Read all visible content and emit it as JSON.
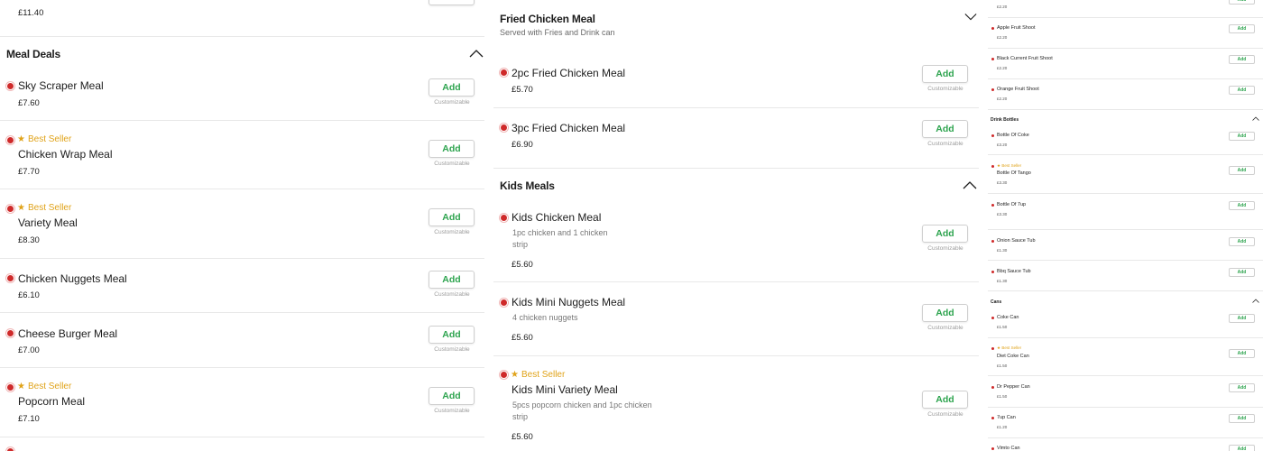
{
  "col1": {
    "top_price": "£11.40",
    "meal_deals": {
      "title": "Meal Deals",
      "items": [
        {
          "name": "Sky Scraper Meal",
          "price": "£7.60",
          "best_seller": false
        },
        {
          "name": "Chicken Wrap Meal",
          "price": "£7.70",
          "best_seller": true
        },
        {
          "name": "Variety Meal",
          "price": "£8.30",
          "best_seller": true
        },
        {
          "name": "Chicken Nuggets Meal",
          "price": "£6.10",
          "best_seller": false
        },
        {
          "name": "Cheese Burger Meal",
          "price": "£7.00",
          "best_seller": false
        },
        {
          "name": "Popcorn Meal",
          "price": "£7.10",
          "best_seller": true
        }
      ]
    }
  },
  "col2": {
    "fried": {
      "title": "Fried Chicken Meal",
      "subtitle": "Served with Fries and Drink can",
      "items": [
        {
          "name": "2pc Fried Chicken Meal",
          "price": "£5.70"
        },
        {
          "name": "3pc Fried Chicken Meal",
          "price": "£6.90"
        }
      ]
    },
    "kids": {
      "title": "Kids Meals",
      "items": [
        {
          "name": "Kids Chicken Meal",
          "desc1": "1pc chicken and 1 chicken",
          "desc2": "strip",
          "price": "£5.60",
          "best_seller": false
        },
        {
          "name": "Kids Mini Nuggets Meal",
          "desc1": "4 chicken nuggets",
          "desc2": "",
          "price": "£5.60",
          "best_seller": false
        },
        {
          "name": "Kids Mini Variety Meal",
          "desc1": "5pcs popcorn chicken and 1pc chicken",
          "desc2": "strip",
          "price": "£5.60",
          "best_seller": true
        }
      ]
    }
  },
  "col3": {
    "top_price": "£2.20",
    "shoots": [
      {
        "name": "Apple Fruit Shoot",
        "price": "£2.20"
      },
      {
        "name": "Black Current Fruit Shoot",
        "price": "£2.20"
      },
      {
        "name": "Orange Fruit Shoot",
        "price": "£2.20"
      }
    ],
    "bottles_title": "Drink Bottles",
    "bottles": [
      {
        "name": "Bottle Of Coke",
        "price": "£3.20",
        "best_seller": false
      },
      {
        "name": "Bottle Of Tango",
        "price": "£3.30",
        "best_seller": true
      },
      {
        "name": "Bottle Of 7up",
        "price": "£3.30",
        "best_seller": false
      },
      {
        "name": "Onion Sauce Tub",
        "price": "£1.30",
        "best_seller": false
      },
      {
        "name": "Bbq Sauce Tub",
        "price": "£1.30",
        "best_seller": false
      }
    ],
    "cans_title": "Cans",
    "cans": [
      {
        "name": "Coke Can",
        "price": "£1.50",
        "best_seller": false
      },
      {
        "name": "Diet Coke Can",
        "price": "£1.50",
        "best_seller": true
      },
      {
        "name": "Dr Pepper Can",
        "price": "£1.50",
        "best_seller": false
      },
      {
        "name": "7up Can",
        "price": "£1.20",
        "best_seller": false
      },
      {
        "name": "Vimto Can",
        "price": "",
        "best_seller": false
      }
    ]
  },
  "labels": {
    "add": "Add",
    "customizable": "Customizable",
    "best_seller": "Best Seller"
  },
  "colors": {
    "accent_green": "#2ea44f",
    "best_seller": "#e0a31a",
    "nonveg_red": "#cf2a2a"
  }
}
